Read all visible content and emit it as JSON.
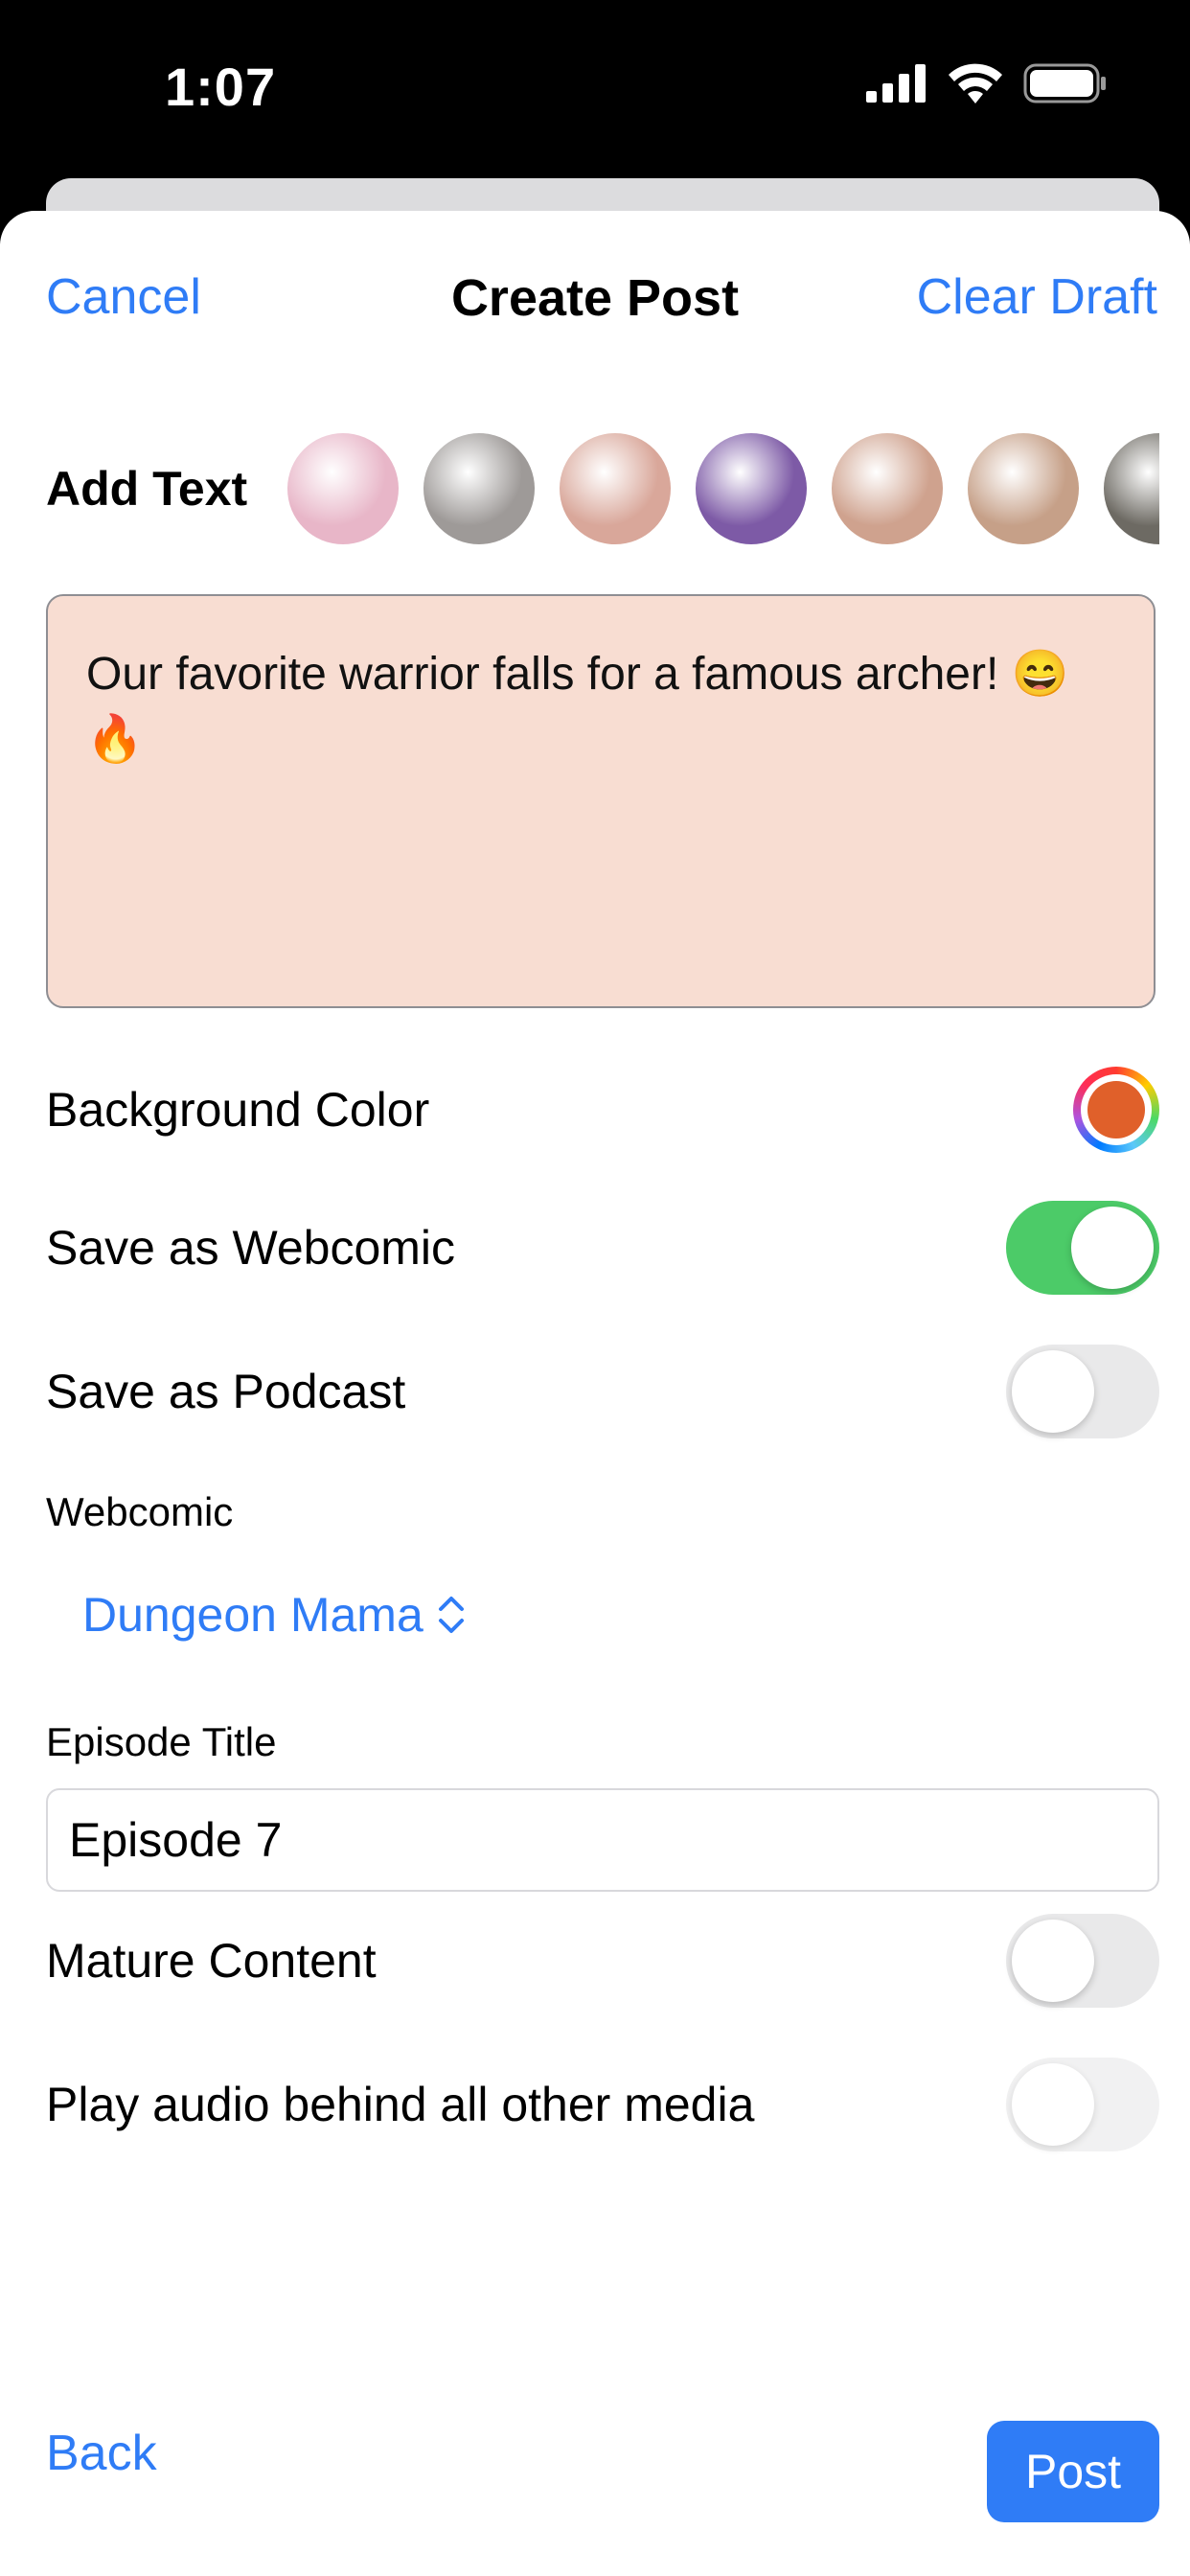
{
  "status_bar": {
    "time": "1:07",
    "icons": [
      "cellular-signal-icon",
      "wifi-icon",
      "battery-icon"
    ]
  },
  "nav": {
    "cancel_label": "Cancel",
    "title": "Create Post",
    "clear_label": "Clear Draft"
  },
  "add_text": {
    "label": "Add Text",
    "thumbnails": [
      {
        "name": "comic-thumbnail-1",
        "color": "#e8b6c8"
      },
      {
        "name": "comic-thumbnail-2",
        "color": "#9e9a98"
      },
      {
        "name": "comic-thumbnail-3",
        "color": "#d9a79a"
      },
      {
        "name": "comic-thumbnail-4",
        "color": "#7d5aa6"
      },
      {
        "name": "comic-thumbnail-5",
        "color": "#cfa28e"
      },
      {
        "name": "comic-thumbnail-6",
        "color": "#c6a088"
      },
      {
        "name": "comic-thumbnail-7",
        "color": "#6d6a63"
      }
    ]
  },
  "post_text": {
    "value": "Our favorite warrior falls for a famous archer! 😄 🔥",
    "background": "#f8ddd2"
  },
  "settings": {
    "background_color_label": "Background Color",
    "background_color_value": "#e0602a",
    "webcomic_toggle_label": "Save as Webcomic",
    "webcomic_toggle_on": true,
    "podcast_toggle_label": "Save as Podcast",
    "podcast_toggle_on": false
  },
  "webcomic": {
    "section_label": "Webcomic",
    "selected": "Dungeon Mama",
    "chevron_icon": "chevron-up-down-icon"
  },
  "episode": {
    "section_label": "Episode Title",
    "value": "Episode 7"
  },
  "mature": {
    "label": "Mature Content",
    "on": false
  },
  "audio": {
    "label": "Play audio behind all other media",
    "on": false
  },
  "bottom": {
    "back_label": "Back",
    "post_label": "Post"
  },
  "colors": {
    "accent": "#2f7cf6",
    "toggle_on": "#4ccb68"
  }
}
